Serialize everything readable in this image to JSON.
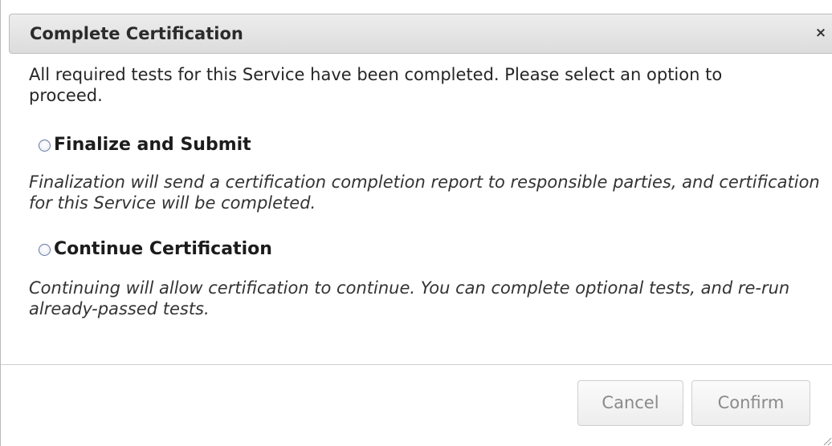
{
  "dialog": {
    "title": "Complete Certification",
    "close_icon": "×",
    "intro": "All required tests for this Service have been completed. Please select an option to proceed.",
    "options": [
      {
        "label": "Finalize and Submit",
        "selected": false,
        "description": "Finalization will send a certification completion report to responsible parties, and certification for this Service will be completed."
      },
      {
        "label": "Continue Certification",
        "selected": false,
        "description": "Continuing will allow certification to continue. You can complete optional tests, and re-run already-passed tests."
      }
    ],
    "buttons": {
      "cancel": "Cancel",
      "confirm": "Confirm"
    }
  }
}
